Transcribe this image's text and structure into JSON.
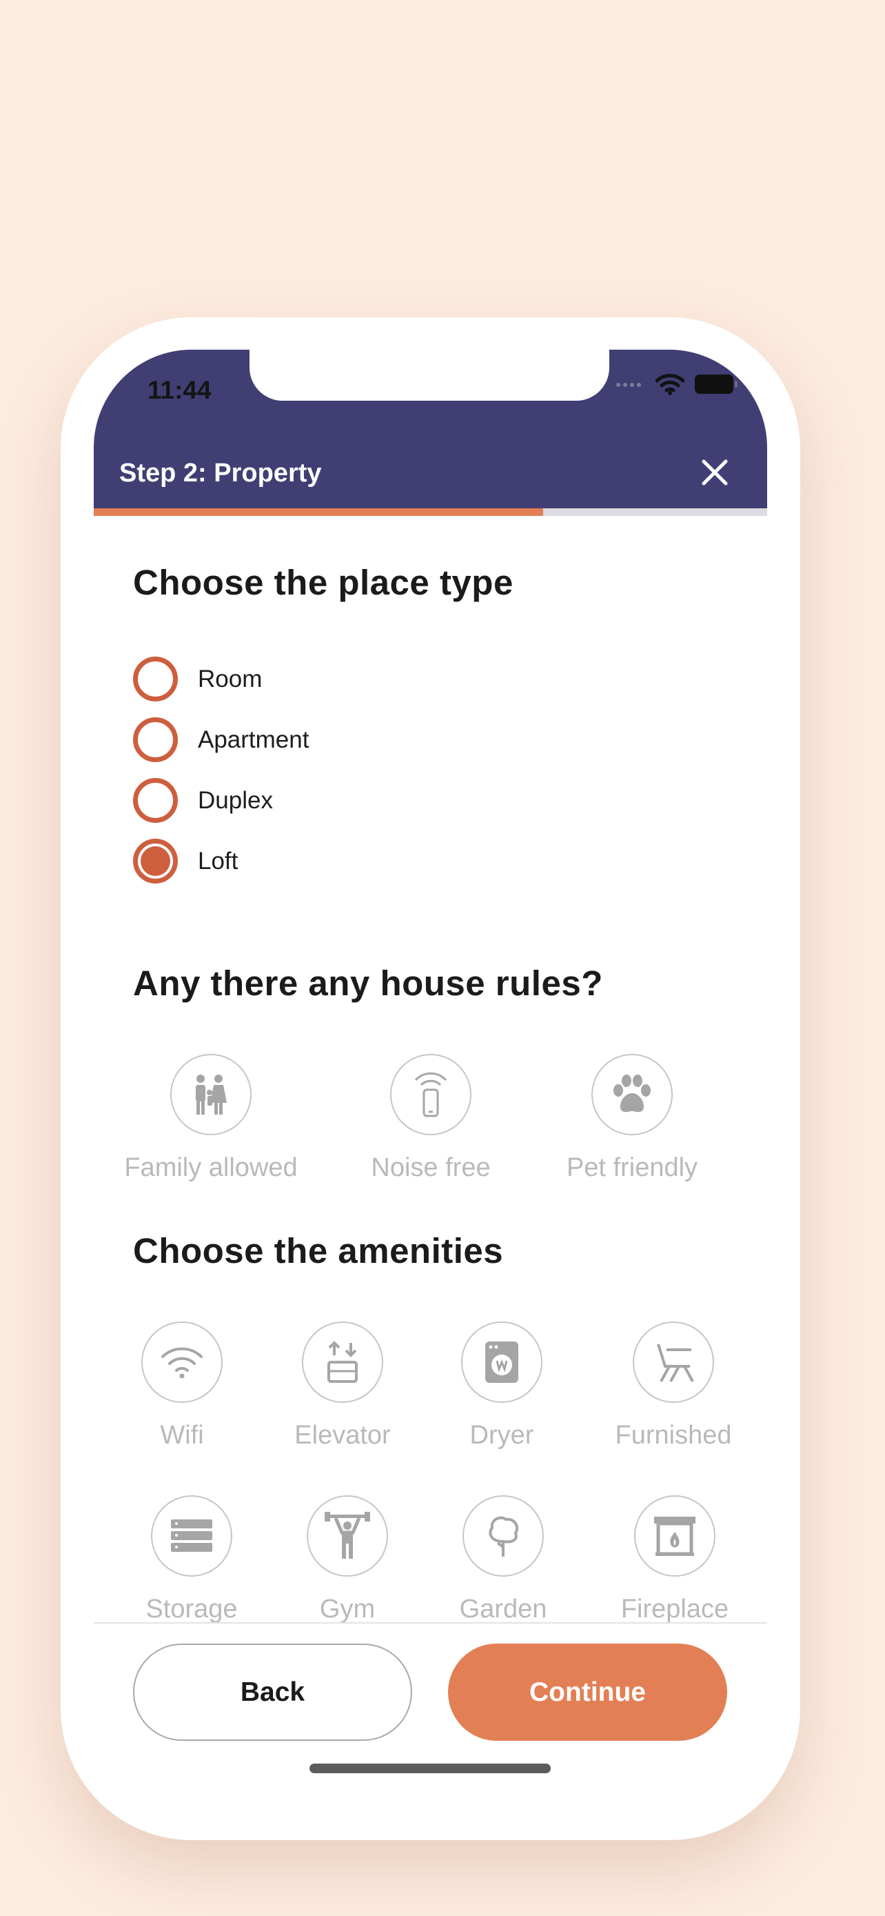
{
  "status_bar": {
    "time": "11:44"
  },
  "header": {
    "title": "Step 2: Property",
    "progress": 0.667
  },
  "place_type": {
    "title": "Choose the place type",
    "options": [
      {
        "label": "Room",
        "selected": false
      },
      {
        "label": "Apartment",
        "selected": false
      },
      {
        "label": "Duplex",
        "selected": false
      },
      {
        "label": "Loft",
        "selected": true
      }
    ]
  },
  "house_rules": {
    "title": "Any there any house rules?",
    "options": [
      {
        "label": "Family allowed",
        "icon": "family-icon"
      },
      {
        "label": "Noise free",
        "icon": "phone-silent-icon"
      },
      {
        "label": "Pet friendly",
        "icon": "paw-icon"
      }
    ]
  },
  "amenities": {
    "title": "Choose the amenities",
    "options": [
      {
        "label": "Wifi",
        "icon": "wifi-icon"
      },
      {
        "label": "Elevator",
        "icon": "elevator-icon"
      },
      {
        "label": "Dryer",
        "icon": "dryer-icon"
      },
      {
        "label": "Furnished",
        "icon": "chair-icon"
      },
      {
        "label": "Storage",
        "icon": "storage-icon"
      },
      {
        "label": "Gym",
        "icon": "weightlifter-icon"
      },
      {
        "label": "Garden",
        "icon": "tree-icon"
      },
      {
        "label": "Fireplace",
        "icon": "fireplace-icon"
      }
    ]
  },
  "footer": {
    "back_label": "Back",
    "continue_label": "Continue"
  },
  "colors": {
    "background": "#fdebdf",
    "header": "#403e73",
    "accent": "#e37f55",
    "radio": "#cd5e3e",
    "muted": "#b9b9b9"
  }
}
